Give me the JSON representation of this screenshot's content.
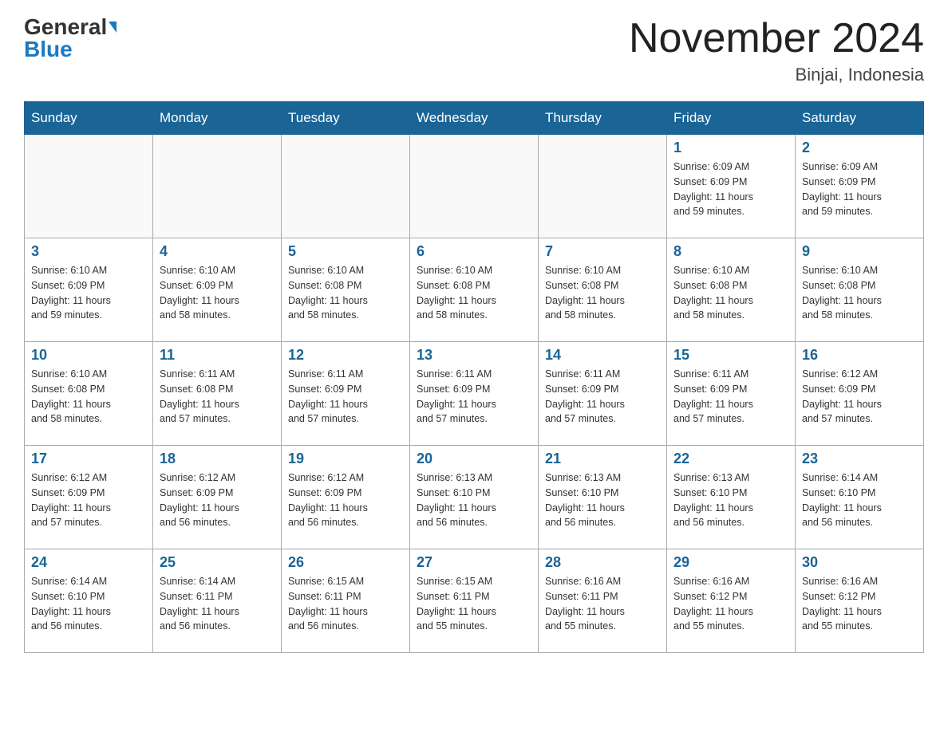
{
  "header": {
    "logo_general": "General",
    "logo_blue": "Blue",
    "title": "November 2024",
    "subtitle": "Binjai, Indonesia"
  },
  "weekdays": [
    "Sunday",
    "Monday",
    "Tuesday",
    "Wednesday",
    "Thursday",
    "Friday",
    "Saturday"
  ],
  "weeks": [
    [
      {
        "day": "",
        "info": ""
      },
      {
        "day": "",
        "info": ""
      },
      {
        "day": "",
        "info": ""
      },
      {
        "day": "",
        "info": ""
      },
      {
        "day": "",
        "info": ""
      },
      {
        "day": "1",
        "info": "Sunrise: 6:09 AM\nSunset: 6:09 PM\nDaylight: 11 hours\nand 59 minutes."
      },
      {
        "day": "2",
        "info": "Sunrise: 6:09 AM\nSunset: 6:09 PM\nDaylight: 11 hours\nand 59 minutes."
      }
    ],
    [
      {
        "day": "3",
        "info": "Sunrise: 6:10 AM\nSunset: 6:09 PM\nDaylight: 11 hours\nand 59 minutes."
      },
      {
        "day": "4",
        "info": "Sunrise: 6:10 AM\nSunset: 6:09 PM\nDaylight: 11 hours\nand 58 minutes."
      },
      {
        "day": "5",
        "info": "Sunrise: 6:10 AM\nSunset: 6:08 PM\nDaylight: 11 hours\nand 58 minutes."
      },
      {
        "day": "6",
        "info": "Sunrise: 6:10 AM\nSunset: 6:08 PM\nDaylight: 11 hours\nand 58 minutes."
      },
      {
        "day": "7",
        "info": "Sunrise: 6:10 AM\nSunset: 6:08 PM\nDaylight: 11 hours\nand 58 minutes."
      },
      {
        "day": "8",
        "info": "Sunrise: 6:10 AM\nSunset: 6:08 PM\nDaylight: 11 hours\nand 58 minutes."
      },
      {
        "day": "9",
        "info": "Sunrise: 6:10 AM\nSunset: 6:08 PM\nDaylight: 11 hours\nand 58 minutes."
      }
    ],
    [
      {
        "day": "10",
        "info": "Sunrise: 6:10 AM\nSunset: 6:08 PM\nDaylight: 11 hours\nand 58 minutes."
      },
      {
        "day": "11",
        "info": "Sunrise: 6:11 AM\nSunset: 6:08 PM\nDaylight: 11 hours\nand 57 minutes."
      },
      {
        "day": "12",
        "info": "Sunrise: 6:11 AM\nSunset: 6:09 PM\nDaylight: 11 hours\nand 57 minutes."
      },
      {
        "day": "13",
        "info": "Sunrise: 6:11 AM\nSunset: 6:09 PM\nDaylight: 11 hours\nand 57 minutes."
      },
      {
        "day": "14",
        "info": "Sunrise: 6:11 AM\nSunset: 6:09 PM\nDaylight: 11 hours\nand 57 minutes."
      },
      {
        "day": "15",
        "info": "Sunrise: 6:11 AM\nSunset: 6:09 PM\nDaylight: 11 hours\nand 57 minutes."
      },
      {
        "day": "16",
        "info": "Sunrise: 6:12 AM\nSunset: 6:09 PM\nDaylight: 11 hours\nand 57 minutes."
      }
    ],
    [
      {
        "day": "17",
        "info": "Sunrise: 6:12 AM\nSunset: 6:09 PM\nDaylight: 11 hours\nand 57 minutes."
      },
      {
        "day": "18",
        "info": "Sunrise: 6:12 AM\nSunset: 6:09 PM\nDaylight: 11 hours\nand 56 minutes."
      },
      {
        "day": "19",
        "info": "Sunrise: 6:12 AM\nSunset: 6:09 PM\nDaylight: 11 hours\nand 56 minutes."
      },
      {
        "day": "20",
        "info": "Sunrise: 6:13 AM\nSunset: 6:10 PM\nDaylight: 11 hours\nand 56 minutes."
      },
      {
        "day": "21",
        "info": "Sunrise: 6:13 AM\nSunset: 6:10 PM\nDaylight: 11 hours\nand 56 minutes."
      },
      {
        "day": "22",
        "info": "Sunrise: 6:13 AM\nSunset: 6:10 PM\nDaylight: 11 hours\nand 56 minutes."
      },
      {
        "day": "23",
        "info": "Sunrise: 6:14 AM\nSunset: 6:10 PM\nDaylight: 11 hours\nand 56 minutes."
      }
    ],
    [
      {
        "day": "24",
        "info": "Sunrise: 6:14 AM\nSunset: 6:10 PM\nDaylight: 11 hours\nand 56 minutes."
      },
      {
        "day": "25",
        "info": "Sunrise: 6:14 AM\nSunset: 6:11 PM\nDaylight: 11 hours\nand 56 minutes."
      },
      {
        "day": "26",
        "info": "Sunrise: 6:15 AM\nSunset: 6:11 PM\nDaylight: 11 hours\nand 56 minutes."
      },
      {
        "day": "27",
        "info": "Sunrise: 6:15 AM\nSunset: 6:11 PM\nDaylight: 11 hours\nand 55 minutes."
      },
      {
        "day": "28",
        "info": "Sunrise: 6:16 AM\nSunset: 6:11 PM\nDaylight: 11 hours\nand 55 minutes."
      },
      {
        "day": "29",
        "info": "Sunrise: 6:16 AM\nSunset: 6:12 PM\nDaylight: 11 hours\nand 55 minutes."
      },
      {
        "day": "30",
        "info": "Sunrise: 6:16 AM\nSunset: 6:12 PM\nDaylight: 11 hours\nand 55 minutes."
      }
    ]
  ]
}
